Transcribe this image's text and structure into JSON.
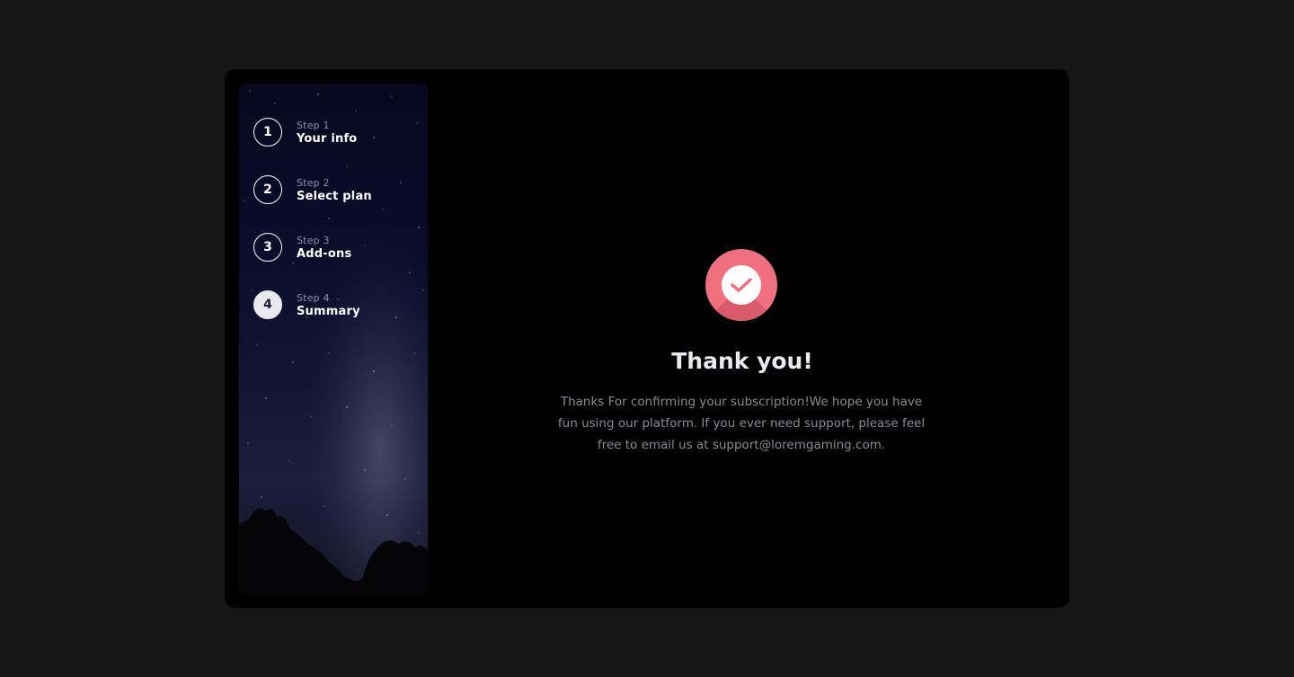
{
  "sidebar": {
    "steps": [
      {
        "number": "1",
        "kicker": "Step 1",
        "title": "Your info",
        "active": false
      },
      {
        "number": "2",
        "kicker": "Step 2",
        "title": "Select plan",
        "active": false
      },
      {
        "number": "3",
        "kicker": "Step 3",
        "title": "Add-ons",
        "active": false
      },
      {
        "number": "4",
        "kicker": "Step 4",
        "title": "Summary",
        "active": true
      }
    ]
  },
  "confirmation": {
    "icon": "check-circle-icon",
    "title": "Thank you!",
    "message": "Thanks For confirming your subscription!We hope you have fun using our platform. If you ever need support, please feel free to email us at support@loremgaming.com."
  },
  "colors": {
    "page_background": "#161616",
    "card_background": "#000000",
    "accent": "#f0707f",
    "text_primary": "#e9e9ee",
    "text_muted": "#8a8a95"
  }
}
